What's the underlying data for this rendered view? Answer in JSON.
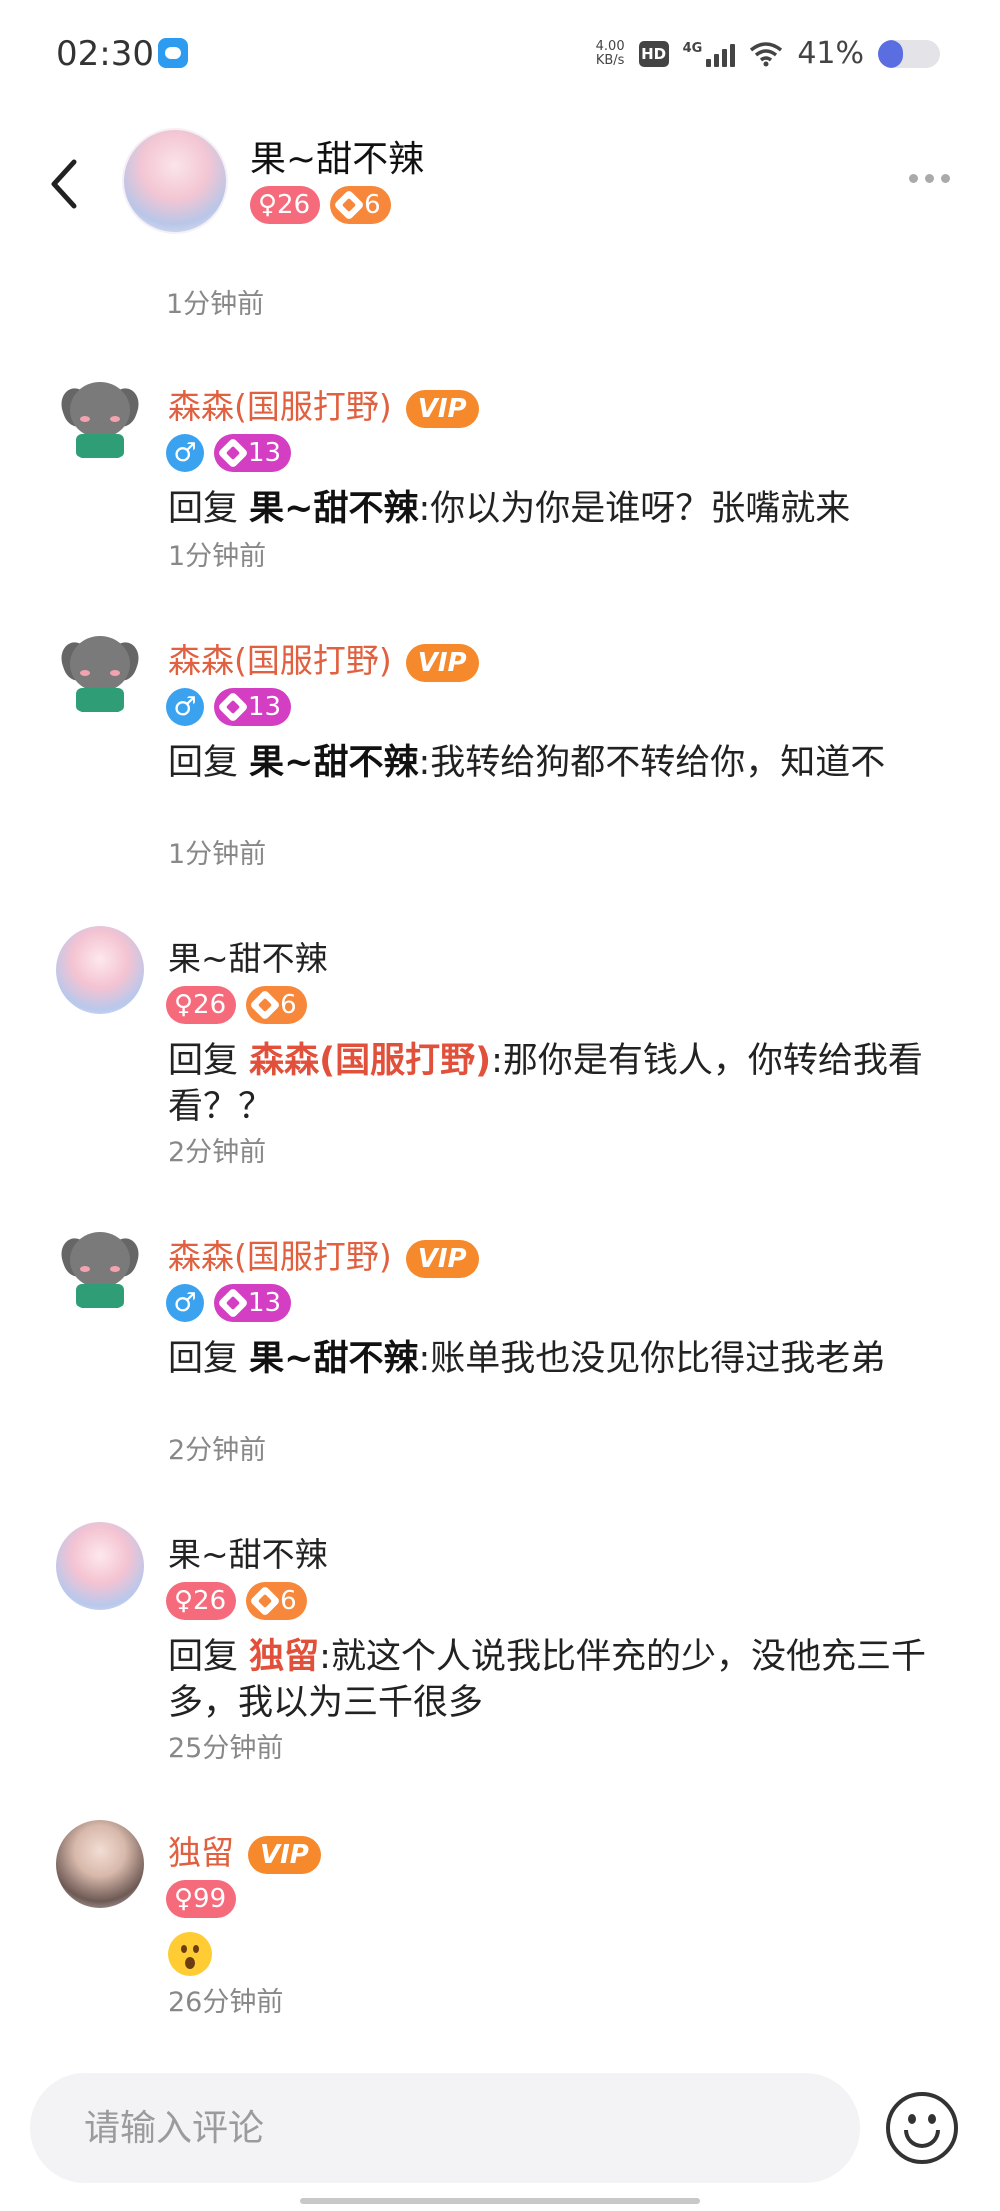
{
  "status_bar": {
    "time": "02:30",
    "net_speed_value": "4.00",
    "net_speed_unit": "KB/s",
    "hd": "HD",
    "network": "4G",
    "battery_percent": "41%",
    "battery_level": 0.41
  },
  "header": {
    "name": "果~甜不辣",
    "gender_age": "♀26",
    "level": "6"
  },
  "top_time": "1分钟前",
  "comments": [
    {
      "name": "森森(国服打野)",
      "vip": "VIP",
      "gender": "♂",
      "level": "13",
      "reply_prefix": "回复 ",
      "reply_to": "果~甜不辣",
      "text": ":你以为你是谁呀？张嘴就来",
      "time": "1分钟前"
    },
    {
      "name": "森森(国服打野)",
      "vip": "VIP",
      "gender": "♂",
      "level": "13",
      "reply_prefix": "回复 ",
      "reply_to": "果~甜不辣",
      "text": ":我转给狗都不转给你，知道不",
      "time": "1分钟前"
    },
    {
      "name": "果~甜不辣",
      "gender_age": "♀26",
      "level": "6",
      "reply_prefix": "回复 ",
      "reply_to": "森森(国服打野)",
      "text": ":那你是有钱人，你转给我看看？？",
      "time": "2分钟前"
    },
    {
      "name": "森森(国服打野)",
      "vip": "VIP",
      "gender": "♂",
      "level": "13",
      "reply_prefix": "回复 ",
      "reply_to": "果~甜不辣",
      "text": ":账单我也没见你比得过我老弟",
      "time": "2分钟前"
    },
    {
      "name": "果~甜不辣",
      "gender_age": "♀26",
      "level": "6",
      "reply_prefix": "回复 ",
      "reply_to": "独留",
      "text": ":就这个人说我比伴充的少，没他充三千多，我以为三千很多",
      "time": "25分钟前"
    },
    {
      "name": "独留",
      "vip": "VIP",
      "gender_age": "♀99",
      "text": "😯",
      "time": "26分钟前"
    }
  ],
  "input": {
    "placeholder": "请输入评论",
    "value": ""
  }
}
